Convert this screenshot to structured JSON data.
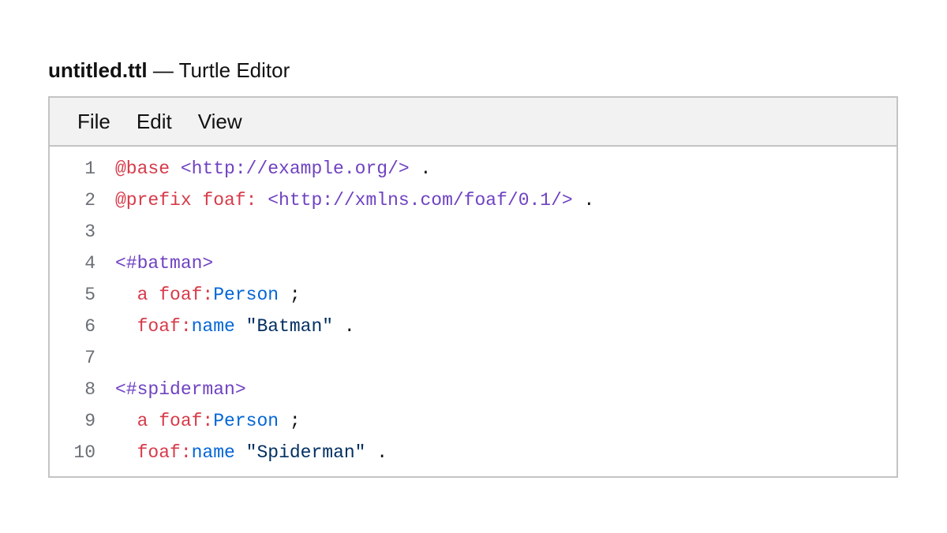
{
  "window": {
    "filename": "untitled.ttl",
    "suffix": " — Turtle Editor"
  },
  "menu": {
    "file": "File",
    "edit": "Edit",
    "view": "View"
  },
  "code": {
    "lines": [
      {
        "num": "1",
        "tokens": [
          "@base",
          " ",
          "<http://example.org/>",
          " ."
        ]
      },
      {
        "num": "2",
        "tokens": [
          "@prefix foaf:",
          " ",
          "<http://xmlns.com/foaf/0.1/>",
          " ."
        ]
      },
      {
        "num": "3",
        "tokens": []
      },
      {
        "num": "4",
        "tokens": [
          "<#batman>"
        ]
      },
      {
        "num": "5",
        "tokens": [
          "  ",
          "a foaf:",
          "Person",
          " ;"
        ]
      },
      {
        "num": "6",
        "tokens": [
          "  ",
          "foaf:",
          "name",
          " ",
          "\"Batman\"",
          " ."
        ]
      },
      {
        "num": "7",
        "tokens": []
      },
      {
        "num": "8",
        "tokens": [
          "<#spiderman>"
        ]
      },
      {
        "num": "9",
        "tokens": [
          "  ",
          "a foaf:",
          "Person",
          " ;"
        ]
      },
      {
        "num": "10",
        "tokens": [
          "  ",
          "foaf:",
          "name",
          " ",
          "\"Spiderman\"",
          " ."
        ]
      }
    ]
  },
  "colors": {
    "keyword": "#d73a49",
    "iri": "#6f42c1",
    "local_name": "#0366d6",
    "string": "#032f62",
    "line_number": "#6a6f75"
  }
}
